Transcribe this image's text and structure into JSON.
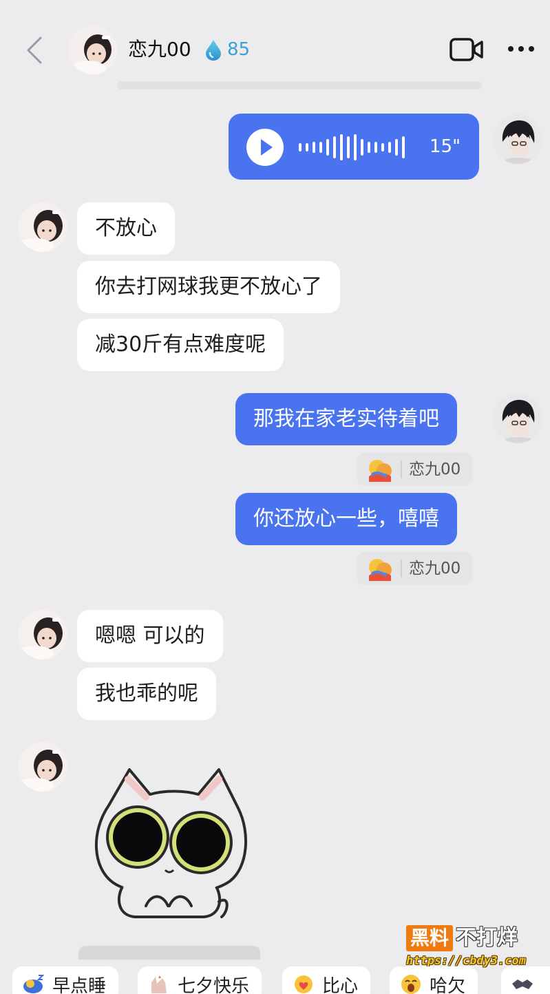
{
  "header": {
    "contact_name": "恋九00",
    "intimacy_value": "85",
    "icons": [
      "back-icon",
      "drop-icon",
      "video-call-icon",
      "more-icon"
    ]
  },
  "messages": [
    {
      "side": "me",
      "type": "voice",
      "duration": "15\""
    },
    {
      "side": "her",
      "type": "text",
      "text": "不放心"
    },
    {
      "side": "her",
      "type": "text",
      "text": "你去打网球我更不放心了"
    },
    {
      "side": "her",
      "type": "text",
      "text": "减30斤有点难度呢"
    },
    {
      "side": "me",
      "type": "text",
      "text": "那我在家老实待着吧"
    },
    {
      "side": "me",
      "type": "reaction",
      "user": "恋九00"
    },
    {
      "side": "me",
      "type": "text",
      "text": "你还放心一些，嘻嘻"
    },
    {
      "side": "me",
      "type": "reaction",
      "user": "恋九00"
    },
    {
      "side": "her",
      "type": "text",
      "text": "嗯嗯 可以的"
    },
    {
      "side": "her",
      "type": "text",
      "text": "我也乖的呢"
    },
    {
      "side": "her",
      "type": "sticker",
      "sticker": "cat-sticker"
    }
  ],
  "quick_replies": [
    "早点睡",
    "七夕快乐",
    "比心",
    "哈欠"
  ],
  "watermark": {
    "brand_box": "黑料",
    "brand_text": "不打烊",
    "url": "https://cbdy3.com"
  },
  "colors": {
    "background": "#ececee",
    "outgoing_bubble": "#4a73f0",
    "incoming_bubble": "#ffffff",
    "intimacy": "#3aa0d8",
    "watermark_orange": "#f07a10"
  }
}
